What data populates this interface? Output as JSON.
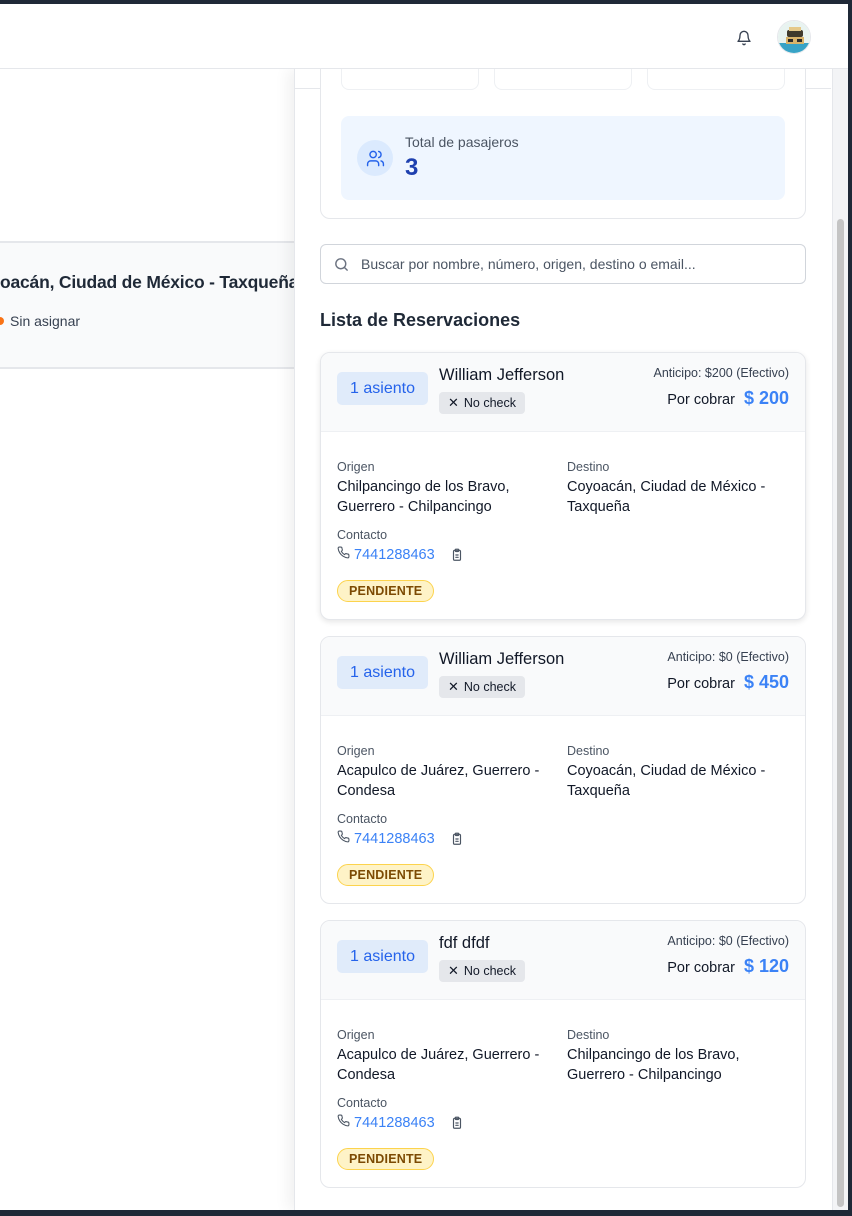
{
  "header": {
    "notifications_icon": "bell-icon",
    "avatar_icon": "user-avatar"
  },
  "background_trip": {
    "route": "oacán, Ciudad de México - Taxqueña",
    "driver_status": "Sin asignar"
  },
  "summary": {
    "passengers_label": "Total de pasajeros",
    "passengers_value": "3"
  },
  "search": {
    "placeholder": "Buscar por nombre, número, origen, destino o email..."
  },
  "list": {
    "title": "Lista de Reservaciones"
  },
  "reservations": [
    {
      "seats": "1 asiento",
      "name": "William Jefferson",
      "check": "No check",
      "anticipo": "Anticipo: $200 (Efectivo)",
      "cobrar_label": "Por cobrar",
      "cobrar_amount": "$ 200",
      "origen_label": "Origen",
      "origen": "Chilpancingo de los Bravo, Guerrero - Chilpancingo",
      "destino_label": "Destino",
      "destino": "Coyoacán, Ciudad de México - Taxqueña",
      "contacto_label": "Contacto",
      "phone": "7441288463",
      "status": "PENDIENTE"
    },
    {
      "seats": "1 asiento",
      "name": "William Jefferson",
      "check": "No check",
      "anticipo": "Anticipo: $0 (Efectivo)",
      "cobrar_label": "Por cobrar",
      "cobrar_amount": "$ 450",
      "origen_label": "Origen",
      "origen": "Acapulco de Juárez, Guerrero - Condesa",
      "destino_label": "Destino",
      "destino": "Coyoacán, Ciudad de México - Taxqueña",
      "contacto_label": "Contacto",
      "phone": "7441288463",
      "status": "PENDIENTE"
    },
    {
      "seats": "1 asiento",
      "name": "fdf dfdf",
      "check": "No check",
      "anticipo": "Anticipo: $0 (Efectivo)",
      "cobrar_label": "Por cobrar",
      "cobrar_amount": "$ 120",
      "origen_label": "Origen",
      "origen": "Acapulco de Juárez, Guerrero - Condesa",
      "destino_label": "Destino",
      "destino": "Chilpancingo de los Bravo, Guerrero - Chilpancingo",
      "contacto_label": "Contacto",
      "phone": "7441288463",
      "status": "PENDIENTE"
    }
  ],
  "colors": {
    "accent": "#3b82f6",
    "pending_bg": "#fef3c7",
    "pending_text": "#7c4a03",
    "summary_bg": "#eff6ff"
  }
}
